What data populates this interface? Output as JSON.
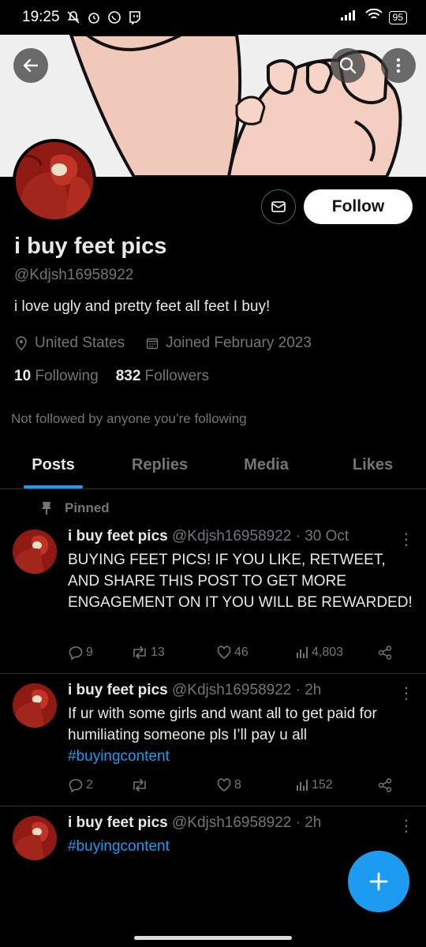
{
  "statusbar": {
    "time": "19:25",
    "battery": "95"
  },
  "profile": {
    "name": "i buy feet pics",
    "handle": "@Kdjsh16958922",
    "bio": "i love ugly and pretty feet all feet I buy!",
    "location": "United States",
    "joined": "Joined February 2023",
    "following_count": "10",
    "following_label": "Following",
    "followers_count": "832",
    "followers_label": "Followers",
    "not_followed": "Not followed by anyone you’re following",
    "follow_label": "Follow"
  },
  "tabs": [
    "Posts",
    "Replies",
    "Media",
    "Likes"
  ],
  "pinned_label": "Pinned",
  "posts": [
    {
      "name": "i buy feet pics",
      "meta": "@Kdjsh16958922 · 30 Oct",
      "text": "BUYING FEET PICS! IF YOU LIKE, RETWEET, AND SHARE THIS POST TO GET MORE ENGAGEMENT ON IT YOU WILL BE REWARDED!",
      "hashtag": "",
      "replies": "9",
      "reposts": "13",
      "likes": "46",
      "views": "4,803"
    },
    {
      "name": "i buy feet pics",
      "meta": "@Kdjsh16958922 · 2h",
      "text": "If ur with some girls and want all to get paid for humiliating someone pls I’ll pay u all",
      "hashtag": "#buyingcontent",
      "replies": "2",
      "reposts": "",
      "likes": "8",
      "views": "152"
    },
    {
      "name": "i buy feet pics",
      "meta": "@Kdjsh16958922 · 2h",
      "text": "",
      "hashtag": "#buyingcontent"
    }
  ],
  "colors": {
    "accent": "#1d9bf0",
    "background": "#000000",
    "muted": "#71767b"
  }
}
